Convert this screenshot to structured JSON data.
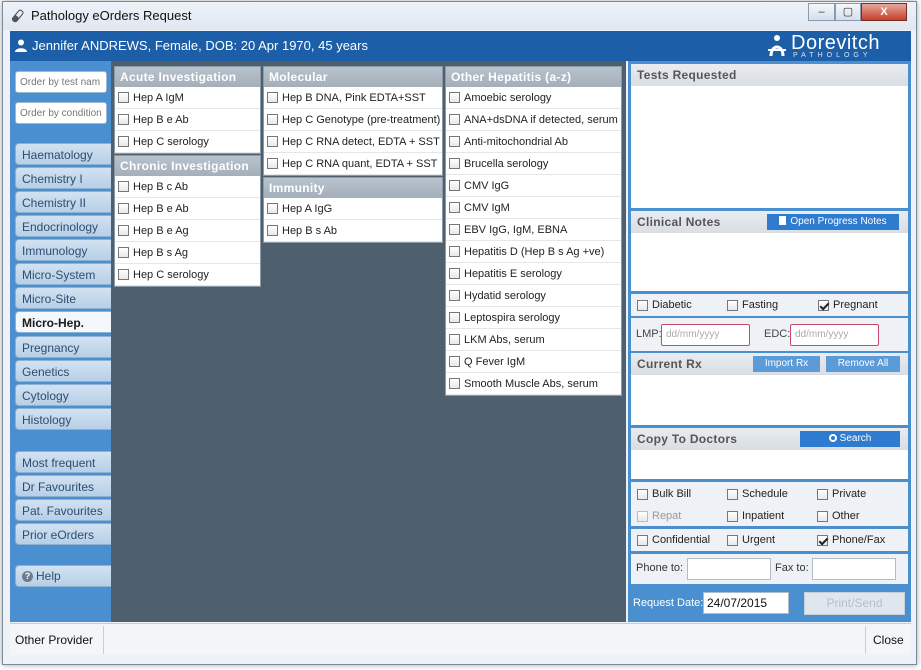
{
  "window": {
    "title": "Pathology eOrders Request",
    "minimize": "–",
    "maximize": "▢",
    "close": "X"
  },
  "patient": {
    "text": "Jennifer ANDREWS, Female, DOB: 20 Apr 1970, 45 years"
  },
  "logo": {
    "name": "Dorevitch",
    "sub": "PATHOLOGY"
  },
  "sidebar": {
    "search_test_placeholder": "Order by test nam",
    "search_condition_placeholder": "Order by condition",
    "tabs": [
      "Haematology",
      "Chemistry I",
      "Chemistry II",
      "Endocrinology",
      "Immunology",
      "Micro-System",
      "Micro-Site",
      "Micro-Hep.",
      "Pregnancy",
      "Genetics",
      "Cytology",
      "Histology"
    ],
    "active_tab": "Micro-Hep.",
    "lower_tabs": [
      "Most frequent",
      "Dr Favourites",
      "Pat. Favourites",
      "Prior eOrders"
    ],
    "help": "Help"
  },
  "panels": {
    "acute": {
      "title": "Acute Investigation",
      "items": [
        "Hep A IgM",
        "Hep B e Ab",
        "Hep C serology"
      ]
    },
    "chronic": {
      "title": "Chronic Investigation",
      "items": [
        "Hep B c Ab",
        "Hep B e Ab",
        "Hep B e Ag",
        "Hep B s Ag",
        "Hep C serology"
      ]
    },
    "molecular": {
      "title": "Molecular",
      "items": [
        "Hep B DNA, Pink EDTA+SST",
        "Hep C Genotype (pre-treatment)",
        "Hep C RNA detect, EDTA + SST",
        "Hep C RNA quant, EDTA + SST"
      ]
    },
    "immunity": {
      "title": "Immunity",
      "items": [
        "Hep A IgG",
        "Hep B s Ab"
      ]
    },
    "other": {
      "title": "Other Hepatitis (a-z)",
      "items": [
        "Amoebic serology",
        "ANA+dsDNA if detected, serum",
        "Anti-mitochondrial Ab",
        "Brucella serology",
        "CMV IgG",
        "CMV IgM",
        "EBV IgG, IgM, EBNA",
        "Hepatitis D (Hep B s Ag +ve)",
        "Hepatitis E serology",
        "Hydatid serology",
        "Leptospira serology",
        "LKM Abs, serum",
        "Q Fever IgM",
        "Smooth Muscle Abs, serum"
      ]
    }
  },
  "right": {
    "tests_requested": "Tests Requested",
    "clinical_notes": "Clinical Notes",
    "open_progress_notes": "Open Progress Notes",
    "diabetic": "Diabetic",
    "fasting": "Fasting",
    "pregnant": "Pregnant",
    "lmp": "LMP:",
    "edc": "EDC:",
    "date_placeholder": "dd/mm/yyyy",
    "current_rx": "Current Rx",
    "import_rx": "Import Rx",
    "remove_all": "Remove All",
    "copy_to_doctors": "Copy To Doctors",
    "search": "Search",
    "bulk_bill": "Bulk Bill",
    "schedule": "Schedule",
    "private": "Private",
    "repat": "Repat",
    "inpatient": "Inpatient",
    "other": "Other",
    "confidential": "Confidential",
    "urgent": "Urgent",
    "phone_fax": "Phone/Fax",
    "phone_to": "Phone to:",
    "fax_to": "Fax to:",
    "request_date": "Request Date:",
    "request_date_value": "24/07/2015",
    "print_send": "Print/Send"
  },
  "status": {
    "other_provider": "Other Provider",
    "close": "Close"
  }
}
